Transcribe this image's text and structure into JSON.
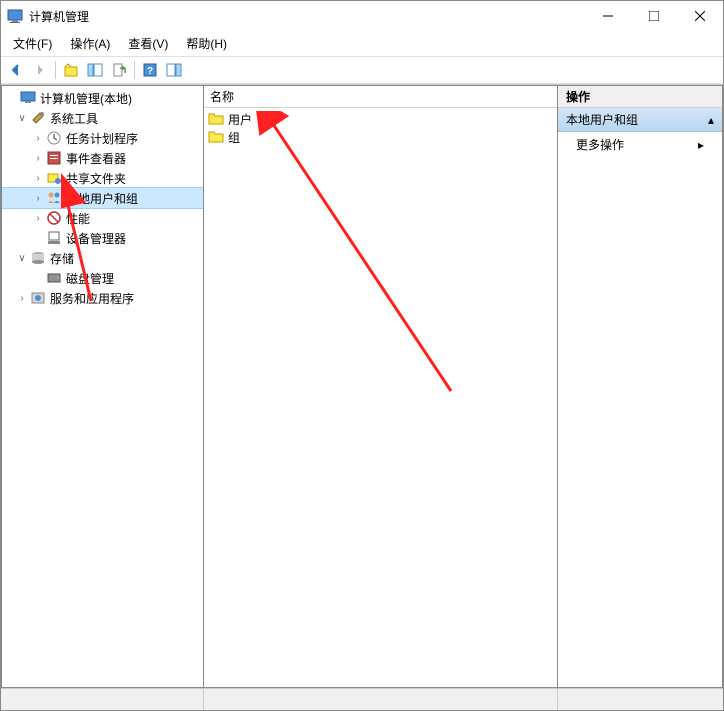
{
  "title": "计算机管理",
  "menubar": {
    "file": "文件(F)",
    "action": "操作(A)",
    "view": "查看(V)",
    "help": "帮助(H)"
  },
  "tree": {
    "root": "计算机管理(本地)",
    "system_tools": "系统工具",
    "task_scheduler": "任务计划程序",
    "event_viewer": "事件查看器",
    "shared_folders": "共享文件夹",
    "local_users_groups": "本地用户和组",
    "performance": "性能",
    "device_manager": "设备管理器",
    "storage": "存储",
    "disk_management": "磁盘管理",
    "services_apps": "服务和应用程序"
  },
  "list": {
    "header": "名称",
    "users": "用户",
    "groups": "组"
  },
  "actions": {
    "header": "操作",
    "group": "本地用户和组",
    "more": "更多操作"
  }
}
